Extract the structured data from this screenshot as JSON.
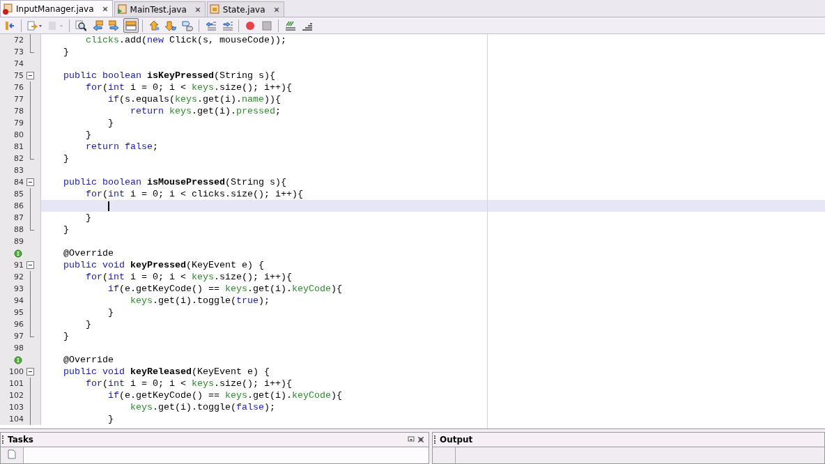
{
  "tabs": [
    {
      "label": "InputManager.java",
      "selected": true,
      "kind": "error"
    },
    {
      "label": "MainTest.java",
      "selected": false,
      "kind": "run"
    },
    {
      "label": "State.java",
      "selected": false,
      "kind": "plain"
    }
  ],
  "toolbar": [
    {
      "kind": "back",
      "selected": false,
      "disabled": false
    },
    {
      "kind": "separator"
    },
    {
      "kind": "history",
      "selected": false,
      "disabled": false
    },
    {
      "kind": "forward-menu",
      "selected": false,
      "disabled": true
    },
    {
      "kind": "separator"
    },
    {
      "kind": "find",
      "selected": false,
      "disabled": false
    },
    {
      "kind": "prev",
      "selected": false,
      "disabled": false
    },
    {
      "kind": "next",
      "selected": false,
      "disabled": false
    },
    {
      "kind": "highlight",
      "selected": true,
      "disabled": false
    },
    {
      "kind": "separator"
    },
    {
      "kind": "bookmark-prev",
      "selected": false,
      "disabled": false
    },
    {
      "kind": "bookmark-next",
      "selected": false,
      "disabled": false
    },
    {
      "kind": "bookmark-toggle",
      "selected": false,
      "disabled": false
    },
    {
      "kind": "separator"
    },
    {
      "kind": "shift-left",
      "selected": false,
      "disabled": false
    },
    {
      "kind": "shift-right",
      "selected": false,
      "disabled": false
    },
    {
      "kind": "separator"
    },
    {
      "kind": "record",
      "selected": false,
      "disabled": false
    },
    {
      "kind": "stop",
      "selected": false,
      "disabled": false
    },
    {
      "kind": "separator"
    },
    {
      "kind": "comment",
      "selected": false,
      "disabled": false
    },
    {
      "kind": "uncomment",
      "selected": false,
      "disabled": false
    }
  ],
  "editor": {
    "lines": [
      {
        "number": "72",
        "kind": "fold-body",
        "current": false,
        "caret": false,
        "tokens": [
          {
            "kind": "field",
            "text": "        clicks"
          },
          {
            "kind": "plain",
            "text": ".add("
          },
          {
            "kind": "keyword",
            "text": "new"
          },
          {
            "kind": "plain",
            "text": " Click(s, mouseCode));"
          }
        ]
      },
      {
        "number": "73",
        "kind": "fold-end",
        "current": false,
        "caret": false,
        "tokens": [
          {
            "kind": "plain",
            "text": "    }"
          }
        ]
      },
      {
        "number": "74",
        "kind": "blank",
        "current": false,
        "caret": false
      },
      {
        "number": "75",
        "kind": "fold-start",
        "current": false,
        "caret": false,
        "tokens": [
          {
            "kind": "keyword",
            "text": "    public boolean "
          },
          {
            "kind": "method",
            "text": "isKeyPressed"
          },
          {
            "kind": "plain",
            "text": "(String s){"
          }
        ]
      },
      {
        "number": "76",
        "kind": "fold-body",
        "current": false,
        "caret": false,
        "tokens": [
          {
            "kind": "keyword",
            "text": "        for"
          },
          {
            "kind": "plain",
            "text": "("
          },
          {
            "kind": "keyword",
            "text": "int"
          },
          {
            "kind": "plain",
            "text": " i = 0; i < "
          },
          {
            "kind": "field",
            "text": "keys"
          },
          {
            "kind": "plain",
            "text": ".size(); i++){"
          }
        ]
      },
      {
        "number": "77",
        "kind": "fold-body",
        "current": false,
        "caret": false,
        "tokens": [
          {
            "kind": "keyword",
            "text": "            if"
          },
          {
            "kind": "plain",
            "text": "(s.equals("
          },
          {
            "kind": "field",
            "text": "keys"
          },
          {
            "kind": "plain",
            "text": ".get(i)."
          },
          {
            "kind": "field",
            "text": "name"
          },
          {
            "kind": "plain",
            "text": ")){"
          }
        ]
      },
      {
        "number": "78",
        "kind": "fold-body",
        "current": false,
        "caret": false,
        "tokens": [
          {
            "kind": "keyword",
            "text": "                return "
          },
          {
            "kind": "field",
            "text": "keys"
          },
          {
            "kind": "plain",
            "text": ".get(i)."
          },
          {
            "kind": "field",
            "text": "pressed"
          },
          {
            "kind": "plain",
            "text": ";"
          }
        ]
      },
      {
        "number": "79",
        "kind": "fold-body",
        "current": false,
        "caret": false,
        "tokens": [
          {
            "kind": "plain",
            "text": "            }"
          }
        ]
      },
      {
        "number": "80",
        "kind": "fold-body",
        "current": false,
        "caret": false,
        "tokens": [
          {
            "kind": "plain",
            "text": "        }"
          }
        ]
      },
      {
        "number": "81",
        "kind": "fold-body",
        "current": false,
        "caret": false,
        "tokens": [
          {
            "kind": "keyword",
            "text": "        return false"
          },
          {
            "kind": "plain",
            "text": ";"
          }
        ]
      },
      {
        "number": "82",
        "kind": "fold-end",
        "current": false,
        "caret": false,
        "tokens": [
          {
            "kind": "plain",
            "text": "    }"
          }
        ]
      },
      {
        "number": "83",
        "kind": "blank",
        "current": false,
        "caret": false
      },
      {
        "number": "84",
        "kind": "fold-start",
        "current": false,
        "caret": false,
        "tokens": [
          {
            "kind": "keyword",
            "text": "    public boolean "
          },
          {
            "kind": "method",
            "text": "isMousePressed"
          },
          {
            "kind": "plain",
            "text": "(String s){"
          }
        ]
      },
      {
        "number": "85",
        "kind": "fold-body",
        "current": false,
        "caret": false,
        "tokens": [
          {
            "kind": "keyword",
            "text": "        for"
          },
          {
            "kind": "plain",
            "text": "("
          },
          {
            "kind": "keyword",
            "text": "int"
          },
          {
            "kind": "plain",
            "text": " i = 0; i < clicks.size(); i++){"
          }
        ]
      },
      {
        "number": "86",
        "kind": "fold-body",
        "current": true,
        "caret": true
      },
      {
        "number": "87",
        "kind": "fold-body",
        "current": false,
        "caret": false,
        "tokens": [
          {
            "kind": "plain",
            "text": "        }"
          }
        ]
      },
      {
        "number": "88",
        "kind": "fold-end",
        "current": false,
        "caret": false,
        "tokens": [
          {
            "kind": "plain",
            "text": "    }"
          }
        ]
      },
      {
        "number": "89",
        "kind": "blank",
        "current": false,
        "caret": false
      },
      {
        "kind": "override",
        "current": false,
        "caret": false,
        "tokens": [
          {
            "kind": "plain",
            "text": "    @Override"
          }
        ]
      },
      {
        "number": "91",
        "kind": "fold-start",
        "current": false,
        "caret": false,
        "tokens": [
          {
            "kind": "keyword",
            "text": "    public void "
          },
          {
            "kind": "method",
            "text": "keyPressed"
          },
          {
            "kind": "plain",
            "text": "(KeyEvent e) {"
          }
        ]
      },
      {
        "number": "92",
        "kind": "fold-body",
        "current": false,
        "caret": false,
        "tokens": [
          {
            "kind": "keyword",
            "text": "        for"
          },
          {
            "kind": "plain",
            "text": "("
          },
          {
            "kind": "keyword",
            "text": "int"
          },
          {
            "kind": "plain",
            "text": " i = 0; i < "
          },
          {
            "kind": "field",
            "text": "keys"
          },
          {
            "kind": "plain",
            "text": ".size(); i++){"
          }
        ]
      },
      {
        "number": "93",
        "kind": "fold-body",
        "current": false,
        "caret": false,
        "tokens": [
          {
            "kind": "keyword",
            "text": "            if"
          },
          {
            "kind": "plain",
            "text": "(e.getKeyCode() == "
          },
          {
            "kind": "field",
            "text": "keys"
          },
          {
            "kind": "plain",
            "text": ".get(i)."
          },
          {
            "kind": "field",
            "text": "keyCode"
          },
          {
            "kind": "plain",
            "text": "){"
          }
        ]
      },
      {
        "number": "94",
        "kind": "fold-body",
        "current": false,
        "caret": false,
        "tokens": [
          {
            "kind": "field",
            "text": "                keys"
          },
          {
            "kind": "plain",
            "text": ".get(i).toggle("
          },
          {
            "kind": "keyword",
            "text": "true"
          },
          {
            "kind": "plain",
            "text": ");"
          }
        ]
      },
      {
        "number": "95",
        "kind": "fold-body",
        "current": false,
        "caret": false,
        "tokens": [
          {
            "kind": "plain",
            "text": "            }"
          }
        ]
      },
      {
        "number": "96",
        "kind": "fold-body",
        "current": false,
        "caret": false,
        "tokens": [
          {
            "kind": "plain",
            "text": "        }"
          }
        ]
      },
      {
        "number": "97",
        "kind": "fold-end",
        "current": false,
        "caret": false,
        "tokens": [
          {
            "kind": "plain",
            "text": "    }"
          }
        ]
      },
      {
        "number": "98",
        "kind": "blank",
        "current": false,
        "caret": false
      },
      {
        "kind": "override",
        "current": false,
        "caret": false,
        "tokens": [
          {
            "kind": "plain",
            "text": "    @Override"
          }
        ]
      },
      {
        "number": "100",
        "kind": "fold-start",
        "current": false,
        "caret": false,
        "tokens": [
          {
            "kind": "keyword",
            "text": "    public void "
          },
          {
            "kind": "method",
            "text": "keyReleased"
          },
          {
            "kind": "plain",
            "text": "(KeyEvent e) {"
          }
        ]
      },
      {
        "number": "101",
        "kind": "fold-body",
        "current": false,
        "caret": false,
        "tokens": [
          {
            "kind": "keyword",
            "text": "        for"
          },
          {
            "kind": "plain",
            "text": "("
          },
          {
            "kind": "keyword",
            "text": "int"
          },
          {
            "kind": "plain",
            "text": " i = 0; i < "
          },
          {
            "kind": "field",
            "text": "keys"
          },
          {
            "kind": "plain",
            "text": ".size(); i++){"
          }
        ]
      },
      {
        "number": "102",
        "kind": "fold-body",
        "current": false,
        "caret": false,
        "tokens": [
          {
            "kind": "keyword",
            "text": "            if"
          },
          {
            "kind": "plain",
            "text": "(e.getKeyCode() == "
          },
          {
            "kind": "field",
            "text": "keys"
          },
          {
            "kind": "plain",
            "text": ".get(i)."
          },
          {
            "kind": "field",
            "text": "keyCode"
          },
          {
            "kind": "plain",
            "text": "){"
          }
        ]
      },
      {
        "number": "103",
        "kind": "fold-body",
        "current": false,
        "caret": false,
        "tokens": [
          {
            "kind": "field",
            "text": "                keys"
          },
          {
            "kind": "plain",
            "text": ".get(i).toggle("
          },
          {
            "kind": "keyword",
            "text": "false"
          },
          {
            "kind": "plain",
            "text": ");"
          }
        ]
      },
      {
        "number": "104",
        "kind": "fold-body",
        "current": false,
        "caret": false,
        "tokens": [
          {
            "kind": "plain",
            "text": "            }"
          }
        ]
      }
    ]
  },
  "panels": [
    {
      "title": "Tasks",
      "kind": "tasks"
    },
    {
      "title": "Output",
      "kind": "output"
    }
  ]
}
